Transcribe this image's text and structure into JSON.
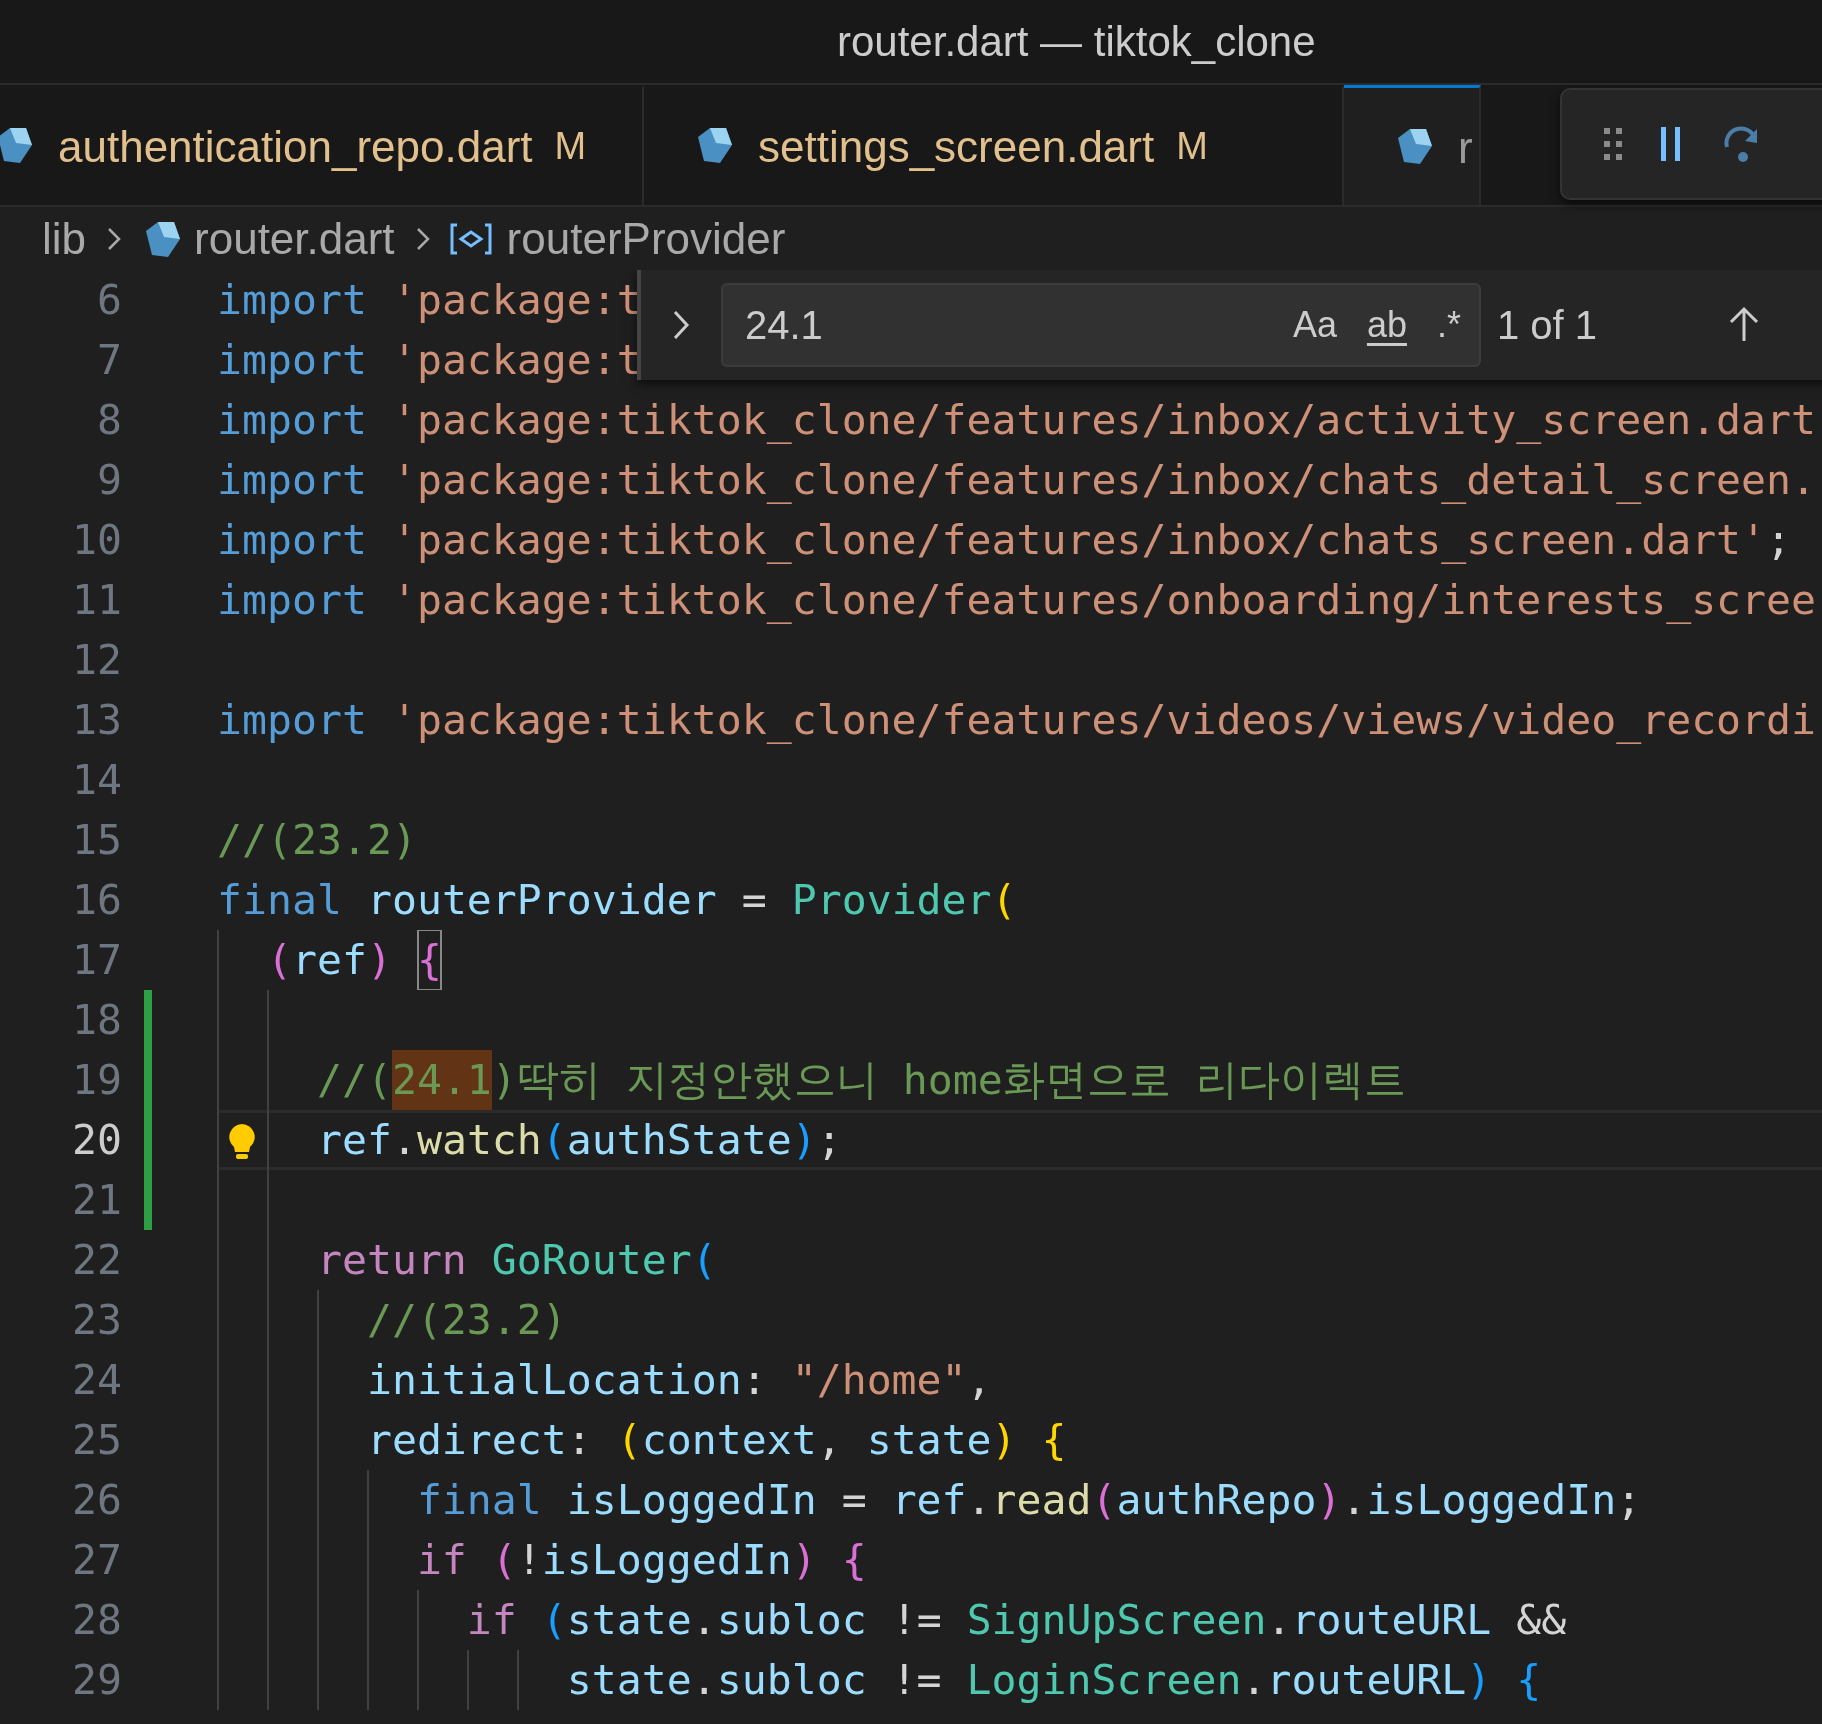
{
  "window": {
    "title": "router.dart — tiktok_clone"
  },
  "tabs": [
    {
      "label": "authentication_repo.dart",
      "badge": "M",
      "selected": false
    },
    {
      "label": "settings_screen.dart",
      "badge": "M",
      "selected": false
    },
    {
      "label": "r",
      "selected": true
    }
  ],
  "breadcrumb": [
    {
      "label": "lib",
      "kind": "folder"
    },
    {
      "label": "router.dart",
      "kind": "file"
    },
    {
      "label": "routerProvider",
      "kind": "symbol"
    }
  ],
  "find_widget": {
    "value": "24.1",
    "options": [
      {
        "label": "Aa",
        "on": false
      },
      {
        "label": "ab",
        "on": false
      },
      {
        "label": ".*",
        "on": false
      }
    ],
    "result": "1 of 1"
  },
  "editor": {
    "lines": [
      {
        "number": "6",
        "modified": false,
        "current": false,
        "lightbulb": false,
        "tokens": [
          {
            "text": "import",
            "kind": "kw"
          },
          {
            "text": " 'package:t",
            "kind": "str"
          }
        ]
      },
      {
        "number": "7",
        "modified": false,
        "current": false,
        "lightbulb": false,
        "tokens": [
          {
            "text": "import",
            "kind": "kw"
          },
          {
            "text": " 'package:t",
            "kind": "str"
          }
        ]
      },
      {
        "number": "8",
        "modified": false,
        "current": false,
        "lightbulb": false,
        "tokens": [
          {
            "text": "import",
            "kind": "kw"
          },
          {
            "text": " 'package:tiktok_clone/features/inbox/activity_screen.dart",
            "kind": "str"
          }
        ]
      },
      {
        "number": "9",
        "modified": false,
        "current": false,
        "lightbulb": false,
        "tokens": [
          {
            "text": "import",
            "kind": "kw"
          },
          {
            "text": " 'package:tiktok_clone/features/inbox/chats_detail_screen.",
            "kind": "str"
          }
        ]
      },
      {
        "number": "10",
        "modified": false,
        "current": false,
        "lightbulb": false,
        "tokens": [
          {
            "text": "import",
            "kind": "kw"
          },
          {
            "text": " 'package:tiktok_clone/features/inbox/chats_screen.dart'",
            "kind": "str"
          },
          {
            "text": ";",
            "kind": "punct"
          }
        ]
      },
      {
        "number": "11",
        "modified": false,
        "current": false,
        "lightbulb": false,
        "tokens": [
          {
            "text": "import",
            "kind": "kw"
          },
          {
            "text": " 'package:tiktok_clone/features/onboarding/interests_scree",
            "kind": "str"
          }
        ]
      },
      {
        "number": "12",
        "modified": false,
        "current": false,
        "lightbulb": false
      },
      {
        "number": "13",
        "modified": false,
        "current": false,
        "lightbulb": false,
        "tokens": [
          {
            "text": "import",
            "kind": "kw"
          },
          {
            "text": " 'package:tiktok_clone/features/videos/views/video_recordi",
            "kind": "str"
          }
        ]
      },
      {
        "number": "14",
        "modified": false,
        "current": false,
        "lightbulb": false
      },
      {
        "number": "15",
        "modified": false,
        "current": false,
        "lightbulb": false,
        "tokens": [
          {
            "text": "//(23.2)",
            "kind": "cmt"
          }
        ]
      },
      {
        "number": "16",
        "modified": false,
        "current": false,
        "lightbulb": false,
        "tokens": [
          {
            "text": "final",
            "kind": "kw"
          },
          {
            "text": " routerProvider",
            "kind": "var"
          },
          {
            "text": " = ",
            "kind": "punct"
          },
          {
            "text": "Provider",
            "kind": "cls"
          },
          {
            "text": "(",
            "kind": "b1"
          }
        ]
      },
      {
        "number": "17",
        "modified": false,
        "current": false,
        "lightbulb": false,
        "tokens": [
          {
            "text": "  (",
            "kind": "b2"
          },
          {
            "text": "ref",
            "kind": "var"
          },
          {
            "text": ")",
            "kind": "b2"
          },
          {
            "text": " {",
            "kind": "b2",
            "bracket_match": true
          }
        ]
      },
      {
        "number": "18",
        "modified": true,
        "current": false,
        "lightbulb": false
      },
      {
        "number": "19",
        "modified": true,
        "current": false,
        "lightbulb": false,
        "tokens": [
          {
            "text": "    //(",
            "kind": "cmt"
          },
          {
            "text": "24.1",
            "kind": "cmt",
            "match": true
          },
          {
            "text": ")딱히 지정안했으니 home화면으로 리다이렉트",
            "kind": "cmt"
          }
        ]
      },
      {
        "number": "20",
        "modified": true,
        "current": true,
        "lightbulb": true,
        "tokens": [
          {
            "text": "    ref",
            "kind": "var"
          },
          {
            "text": ".",
            "kind": "punct"
          },
          {
            "text": "watch",
            "kind": "fn"
          },
          {
            "text": "(",
            "kind": "b3"
          },
          {
            "text": "authState",
            "kind": "var"
          },
          {
            "text": ")",
            "kind": "b3"
          },
          {
            "text": ";",
            "kind": "punct"
          }
        ]
      },
      {
        "number": "21",
        "modified": true,
        "current": false,
        "lightbulb": false
      },
      {
        "number": "22",
        "modified": false,
        "current": false,
        "lightbulb": false,
        "tokens": [
          {
            "text": "    return",
            "kind": "ctrl"
          },
          {
            "text": " GoRouter",
            "kind": "cls"
          },
          {
            "text": "(",
            "kind": "b3"
          }
        ]
      },
      {
        "number": "23",
        "modified": false,
        "current": false,
        "lightbulb": false,
        "tokens": [
          {
            "text": "      //(23.2)",
            "kind": "cmt"
          }
        ]
      },
      {
        "number": "24",
        "modified": false,
        "current": false,
        "lightbulb": false,
        "tokens": [
          {
            "text": "      initialLocation",
            "kind": "var"
          },
          {
            "text": ": ",
            "kind": "punct"
          },
          {
            "text": "\"/home\"",
            "kind": "str"
          },
          {
            "text": ",",
            "kind": "punct"
          }
        ]
      },
      {
        "number": "25",
        "modified": false,
        "current": false,
        "lightbulb": false,
        "tokens": [
          {
            "text": "      redirect",
            "kind": "var"
          },
          {
            "text": ": ",
            "kind": "punct"
          },
          {
            "text": "(",
            "kind": "b1"
          },
          {
            "text": "context",
            "kind": "var"
          },
          {
            "text": ", ",
            "kind": "punct"
          },
          {
            "text": "state",
            "kind": "var"
          },
          {
            "text": ")",
            "kind": "b1"
          },
          {
            "text": " {",
            "kind": "b1"
          }
        ]
      },
      {
        "number": "26",
        "modified": false,
        "current": false,
        "lightbulb": false,
        "tokens": [
          {
            "text": "        final",
            "kind": "kw"
          },
          {
            "text": " isLoggedIn",
            "kind": "var"
          },
          {
            "text": " = ",
            "kind": "punct"
          },
          {
            "text": "ref",
            "kind": "var"
          },
          {
            "text": ".",
            "kind": "punct"
          },
          {
            "text": "read",
            "kind": "fn"
          },
          {
            "text": "(",
            "kind": "b2"
          },
          {
            "text": "authRepo",
            "kind": "var"
          },
          {
            "text": ")",
            "kind": "b2"
          },
          {
            "text": ".",
            "kind": "punct"
          },
          {
            "text": "isLoggedIn",
            "kind": "var"
          },
          {
            "text": ";",
            "kind": "punct"
          }
        ]
      },
      {
        "number": "27",
        "modified": false,
        "current": false,
        "lightbulb": false,
        "tokens": [
          {
            "text": "        if",
            "kind": "ctrl"
          },
          {
            "text": " (",
            "kind": "b2"
          },
          {
            "text": "!",
            "kind": "punct"
          },
          {
            "text": "isLoggedIn",
            "kind": "var"
          },
          {
            "text": ")",
            "kind": "b2"
          },
          {
            "text": " {",
            "kind": "b2"
          }
        ]
      },
      {
        "number": "28",
        "modified": false,
        "current": false,
        "lightbulb": false,
        "tokens": [
          {
            "text": "          if",
            "kind": "ctrl"
          },
          {
            "text": " (",
            "kind": "b3"
          },
          {
            "text": "state",
            "kind": "var"
          },
          {
            "text": ".",
            "kind": "punct"
          },
          {
            "text": "subloc",
            "kind": "var"
          },
          {
            "text": " != ",
            "kind": "punct"
          },
          {
            "text": "SignUpScreen",
            "kind": "cls"
          },
          {
            "text": ".",
            "kind": "punct"
          },
          {
            "text": "routeURL",
            "kind": "var"
          },
          {
            "text": " &&",
            "kind": "punct"
          }
        ]
      },
      {
        "number": "29",
        "modified": false,
        "current": false,
        "lightbulb": false,
        "tokens": [
          {
            "text": "              state",
            "kind": "var"
          },
          {
            "text": ".",
            "kind": "punct"
          },
          {
            "text": "subloc",
            "kind": "var"
          },
          {
            "text": " != ",
            "kind": "punct"
          },
          {
            "text": "LoginScreen",
            "kind": "cls"
          },
          {
            "text": ".",
            "kind": "punct"
          },
          {
            "text": "routeURL",
            "kind": "var"
          },
          {
            "text": ")",
            "kind": "b3"
          },
          {
            "text": " {",
            "kind": "b3"
          }
        ]
      }
    ]
  }
}
